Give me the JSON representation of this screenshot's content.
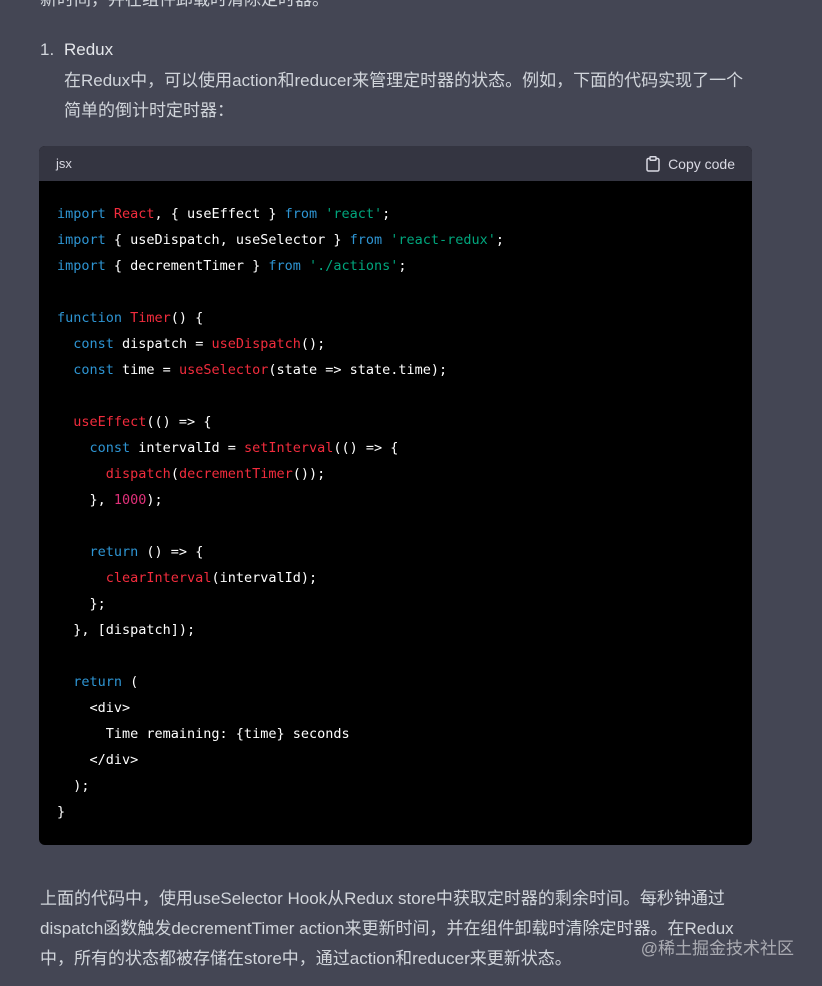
{
  "top_partial_text": "新时间，并在组件卸载时清除定时器。",
  "list": {
    "number": "1.",
    "title": "Redux",
    "text": "在Redux中，可以使用action和reducer来管理定时器的状态。例如，下面的代码实现了一个简单的倒计时定时器："
  },
  "code": {
    "language": "jsx",
    "copy_label": "Copy code",
    "copy_icon": "clipboard-icon",
    "lines": [
      [
        [
          "kw",
          "import "
        ],
        [
          "fn",
          "React"
        ],
        [
          "pl",
          ", { useEffect } "
        ],
        [
          "kw",
          "from "
        ],
        [
          "str",
          "'react'"
        ],
        [
          "pl",
          ";"
        ]
      ],
      [
        [
          "kw",
          "import "
        ],
        [
          "pl",
          "{ useDispatch, useSelector } "
        ],
        [
          "kw",
          "from "
        ],
        [
          "str",
          "'react-redux'"
        ],
        [
          "pl",
          ";"
        ]
      ],
      [
        [
          "kw",
          "import "
        ],
        [
          "pl",
          "{ decrementTimer } "
        ],
        [
          "kw",
          "from "
        ],
        [
          "str",
          "'./actions'"
        ],
        [
          "pl",
          ";"
        ]
      ],
      [],
      [
        [
          "kw",
          "function "
        ],
        [
          "fn",
          "Timer"
        ],
        [
          "pl",
          "() {"
        ]
      ],
      [
        [
          "pl",
          "  "
        ],
        [
          "kw",
          "const "
        ],
        [
          "pl",
          "dispatch = "
        ],
        [
          "fn",
          "useDispatch"
        ],
        [
          "pl",
          "();"
        ]
      ],
      [
        [
          "pl",
          "  "
        ],
        [
          "kw",
          "const "
        ],
        [
          "pl",
          "time = "
        ],
        [
          "fn",
          "useSelector"
        ],
        [
          "pl",
          "(state => state.time);"
        ]
      ],
      [],
      [
        [
          "pl",
          "  "
        ],
        [
          "fn",
          "useEffect"
        ],
        [
          "pl",
          "(() => {"
        ]
      ],
      [
        [
          "pl",
          "    "
        ],
        [
          "kw",
          "const "
        ],
        [
          "pl",
          "intervalId = "
        ],
        [
          "fn",
          "setInterval"
        ],
        [
          "pl",
          "(() => {"
        ]
      ],
      [
        [
          "pl",
          "      "
        ],
        [
          "fn",
          "dispatch"
        ],
        [
          "pl",
          "("
        ],
        [
          "fn",
          "decrementTimer"
        ],
        [
          "pl",
          "());"
        ]
      ],
      [
        [
          "pl",
          "    }, "
        ],
        [
          "num",
          "1000"
        ],
        [
          "pl",
          ");"
        ]
      ],
      [],
      [
        [
          "pl",
          "    "
        ],
        [
          "kw",
          "return "
        ],
        [
          "pl",
          "() => {"
        ]
      ],
      [
        [
          "pl",
          "      "
        ],
        [
          "fn",
          "clearInterval"
        ],
        [
          "pl",
          "(intervalId);"
        ]
      ],
      [
        [
          "pl",
          "    };"
        ]
      ],
      [
        [
          "pl",
          "  }, [dispatch]);"
        ]
      ],
      [],
      [
        [
          "pl",
          "  "
        ],
        [
          "kw",
          "return "
        ],
        [
          "pl",
          "("
        ]
      ],
      [
        [
          "pl",
          "    <div>"
        ]
      ],
      [
        [
          "pl",
          "      Time remaining: {time} seconds"
        ]
      ],
      [
        [
          "pl",
          "    </div>"
        ]
      ],
      [
        [
          "pl",
          "  );"
        ]
      ],
      [
        [
          "pl",
          "}"
        ]
      ]
    ]
  },
  "paragraph": "上面的代码中，使用useSelector Hook从Redux store中获取定时器的剩余时间。每秒钟通过dispatch函数触发decrementTimer action来更新时间，并在组件卸载时清除定时器。在Redux中，所有的状态都被存储在store中，通过action和reducer来更新状态。",
  "watermark": "@稀土掘金技术社区",
  "colors": {
    "page_bg": "#444654",
    "code_bg": "#000000",
    "code_header_bg": "#343541",
    "keyword": "#2e95d3",
    "function": "#f22c3d",
    "string": "#00a67d",
    "number": "#df3079"
  }
}
